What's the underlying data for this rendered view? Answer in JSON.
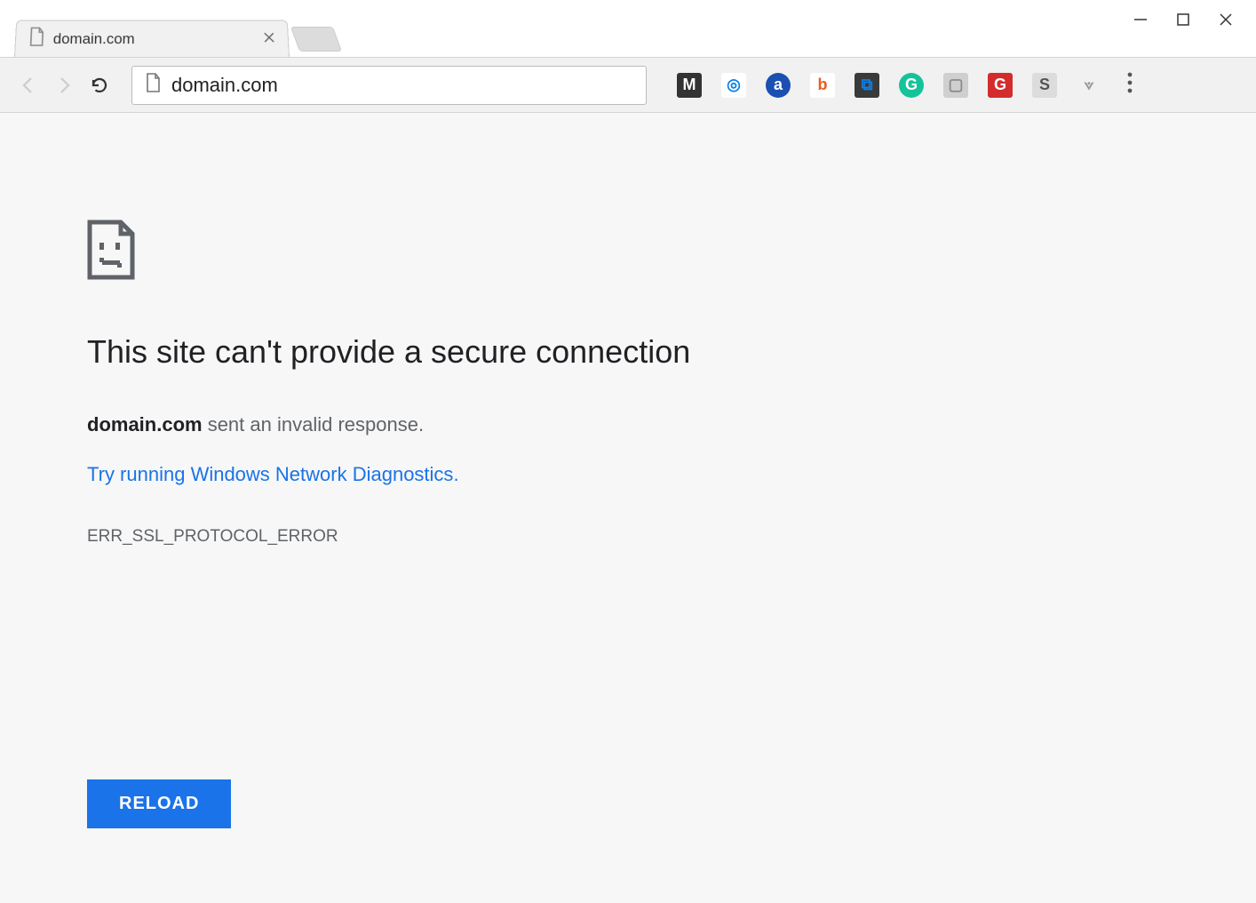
{
  "window": {
    "title_bar": {}
  },
  "tab": {
    "title": "domain.com",
    "favicon": "file-icon"
  },
  "toolbar": {
    "url": "domain.com"
  },
  "extensions": [
    {
      "name": "mega-icon",
      "bg": "#333333",
      "fg": "#ffffff",
      "letter": "M"
    },
    {
      "name": "honey-icon",
      "bg": "#ffffff",
      "fg": "#0b80e6",
      "letter": "◎"
    },
    {
      "name": "alexa-icon",
      "bg": "#1b4fb1",
      "fg": "#ffffff",
      "letter": "a"
    },
    {
      "name": "bitly-icon",
      "bg": "#ffffff",
      "fg": "#e85b22",
      "letter": "b"
    },
    {
      "name": "screenshot-icon",
      "bg": "#3a3a3a",
      "fg": "#0b80e6",
      "letter": "⧉"
    },
    {
      "name": "grammarly-icon",
      "bg": "#15c39a",
      "fg": "#ffffff",
      "letter": "G"
    },
    {
      "name": "clipboard-icon",
      "bg": "#cfcfcf",
      "fg": "#888888",
      "letter": "▢"
    },
    {
      "name": "getpocket-icon",
      "bg": "#d42c2c",
      "fg": "#ffffff",
      "letter": "G"
    },
    {
      "name": "similarweb-icon",
      "bg": "#dcdcdc",
      "fg": "#555555",
      "letter": "S"
    },
    {
      "name": "dev-icon",
      "bg": "transparent",
      "fg": "#9a9a9a",
      "letter": "⟇"
    }
  ],
  "error": {
    "heading": "This site can't provide a secure connection",
    "domain_bold": "domain.com",
    "desc_tail": " sent an invalid response.",
    "suggestion_link": "Try running Windows Network Diagnostics",
    "suggestion_tail": ".",
    "code": "ERR_SSL_PROTOCOL_ERROR",
    "reload_label": "RELOAD"
  }
}
